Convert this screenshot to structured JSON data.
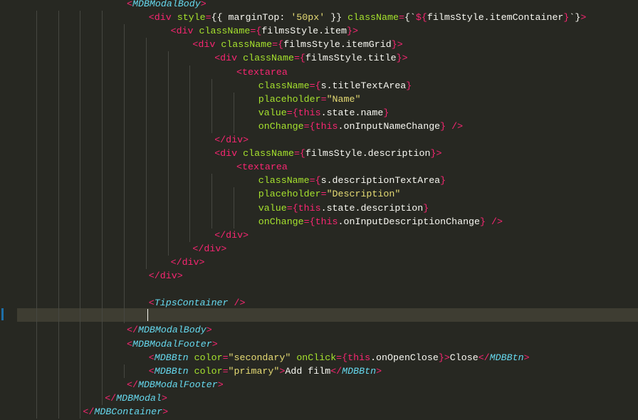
{
  "editor": {
    "theme_colors": {
      "background": "#272822",
      "tag": "#f92672",
      "component": "#66d9ef",
      "attribute": "#a6e22e",
      "string": "#e6db74",
      "text": "#f8f8f2",
      "current_line": "#3e3d32",
      "gutter_marker": "#1e6fa8"
    },
    "lines": [
      {
        "indent": 20,
        "tokens": [
          [
            "tag",
            "<"
          ],
          [
            "comp",
            "MDBModalBody"
          ],
          [
            "tag",
            ">"
          ]
        ]
      },
      {
        "indent": 24,
        "tokens": [
          [
            "tag",
            "<"
          ],
          [
            "kw",
            "div"
          ],
          [
            "plain",
            " "
          ],
          [
            "attr",
            "style"
          ],
          [
            "kw",
            "="
          ],
          [
            "plain",
            "{{ marginTop: "
          ],
          [
            "str",
            "'50px'"
          ],
          [
            "plain",
            " }} "
          ],
          [
            "attr",
            "className"
          ],
          [
            "kw",
            "="
          ],
          [
            "plain",
            "{`"
          ],
          [
            "kw",
            "${"
          ],
          [
            "plain",
            "filmsStyle.itemContainer"
          ],
          [
            "kw",
            "}"
          ],
          [
            "plain",
            "`}"
          ],
          [
            "tag",
            ">"
          ]
        ]
      },
      {
        "indent": 28,
        "tokens": [
          [
            "tag",
            "<"
          ],
          [
            "kw",
            "div"
          ],
          [
            "plain",
            " "
          ],
          [
            "attr",
            "className"
          ],
          [
            "kw",
            "="
          ],
          [
            "kw",
            "{"
          ],
          [
            "plain",
            "filmsStyle.item"
          ],
          [
            "kw",
            "}"
          ],
          [
            "tag",
            ">"
          ]
        ]
      },
      {
        "indent": 32,
        "tokens": [
          [
            "tag",
            "<"
          ],
          [
            "kw",
            "div"
          ],
          [
            "plain",
            " "
          ],
          [
            "attr",
            "className"
          ],
          [
            "kw",
            "="
          ],
          [
            "kw",
            "{"
          ],
          [
            "plain",
            "filmsStyle.itemGrid"
          ],
          [
            "kw",
            "}"
          ],
          [
            "tag",
            ">"
          ]
        ]
      },
      {
        "indent": 36,
        "tokens": [
          [
            "tag",
            "<"
          ],
          [
            "kw",
            "div"
          ],
          [
            "plain",
            " "
          ],
          [
            "attr",
            "className"
          ],
          [
            "kw",
            "="
          ],
          [
            "kw",
            "{"
          ],
          [
            "plain",
            "filmsStyle.title"
          ],
          [
            "kw",
            "}"
          ],
          [
            "tag",
            ">"
          ]
        ]
      },
      {
        "indent": 40,
        "tokens": [
          [
            "tag",
            "<"
          ],
          [
            "kw",
            "textarea"
          ]
        ]
      },
      {
        "indent": 44,
        "tokens": [
          [
            "attr",
            "className"
          ],
          [
            "kw",
            "="
          ],
          [
            "kw",
            "{"
          ],
          [
            "plain",
            "s.titleTextArea"
          ],
          [
            "kw",
            "}"
          ]
        ]
      },
      {
        "indent": 44,
        "tokens": [
          [
            "attr",
            "placeholder"
          ],
          [
            "kw",
            "="
          ],
          [
            "str",
            "\"Name\""
          ]
        ]
      },
      {
        "indent": 44,
        "tokens": [
          [
            "attr",
            "value"
          ],
          [
            "kw",
            "="
          ],
          [
            "kw",
            "{"
          ],
          [
            "kw",
            "this"
          ],
          [
            "plain",
            ".state.name"
          ],
          [
            "kw",
            "}"
          ]
        ]
      },
      {
        "indent": 44,
        "tokens": [
          [
            "attr",
            "onChange"
          ],
          [
            "kw",
            "="
          ],
          [
            "kw",
            "{"
          ],
          [
            "kw",
            "this"
          ],
          [
            "plain",
            ".onInputNameChange"
          ],
          [
            "kw",
            "}"
          ],
          [
            "plain",
            " "
          ],
          [
            "tag",
            "/>"
          ]
        ]
      },
      {
        "indent": 36,
        "tokens": [
          [
            "tag",
            "</"
          ],
          [
            "kw",
            "div"
          ],
          [
            "tag",
            ">"
          ]
        ]
      },
      {
        "indent": 36,
        "tokens": [
          [
            "tag",
            "<"
          ],
          [
            "kw",
            "div"
          ],
          [
            "plain",
            " "
          ],
          [
            "attr",
            "className"
          ],
          [
            "kw",
            "="
          ],
          [
            "kw",
            "{"
          ],
          [
            "plain",
            "filmsStyle.description"
          ],
          [
            "kw",
            "}"
          ],
          [
            "tag",
            ">"
          ]
        ]
      },
      {
        "indent": 40,
        "tokens": [
          [
            "tag",
            "<"
          ],
          [
            "kw",
            "textarea"
          ]
        ]
      },
      {
        "indent": 44,
        "tokens": [
          [
            "attr",
            "className"
          ],
          [
            "kw",
            "="
          ],
          [
            "kw",
            "{"
          ],
          [
            "plain",
            "s.descriptionTextArea"
          ],
          [
            "kw",
            "}"
          ]
        ]
      },
      {
        "indent": 44,
        "tokens": [
          [
            "attr",
            "placeholder"
          ],
          [
            "kw",
            "="
          ],
          [
            "str",
            "\"Description\""
          ]
        ]
      },
      {
        "indent": 44,
        "tokens": [
          [
            "attr",
            "value"
          ],
          [
            "kw",
            "="
          ],
          [
            "kw",
            "{"
          ],
          [
            "kw",
            "this"
          ],
          [
            "plain",
            ".state.description"
          ],
          [
            "kw",
            "}"
          ]
        ]
      },
      {
        "indent": 44,
        "tokens": [
          [
            "attr",
            "onChange"
          ],
          [
            "kw",
            "="
          ],
          [
            "kw",
            "{"
          ],
          [
            "kw",
            "this"
          ],
          [
            "plain",
            ".onInputDescriptionChange"
          ],
          [
            "kw",
            "}"
          ],
          [
            "plain",
            " "
          ],
          [
            "tag",
            "/>"
          ]
        ]
      },
      {
        "indent": 36,
        "tokens": [
          [
            "tag",
            "</"
          ],
          [
            "kw",
            "div"
          ],
          [
            "tag",
            ">"
          ]
        ]
      },
      {
        "indent": 32,
        "tokens": [
          [
            "tag",
            "</"
          ],
          [
            "kw",
            "div"
          ],
          [
            "tag",
            ">"
          ]
        ]
      },
      {
        "indent": 28,
        "tokens": [
          [
            "tag",
            "</"
          ],
          [
            "kw",
            "div"
          ],
          [
            "tag",
            ">"
          ]
        ]
      },
      {
        "indent": 24,
        "tokens": [
          [
            "tag",
            "</"
          ],
          [
            "kw",
            "div"
          ],
          [
            "tag",
            ">"
          ]
        ]
      },
      {
        "indent": 0,
        "tokens": []
      },
      {
        "indent": 24,
        "tokens": [
          [
            "tag",
            "<"
          ],
          [
            "comp",
            "TipsContainer"
          ],
          [
            "plain",
            " "
          ],
          [
            "tag",
            "/>"
          ]
        ]
      },
      {
        "indent": 0,
        "tokens": []
      },
      {
        "indent": 20,
        "tokens": [
          [
            "tag",
            "</"
          ],
          [
            "comp",
            "MDBModalBody"
          ],
          [
            "tag",
            ">"
          ]
        ]
      },
      {
        "indent": 20,
        "tokens": [
          [
            "tag",
            "<"
          ],
          [
            "comp",
            "MDBModalFooter"
          ],
          [
            "tag",
            ">"
          ]
        ]
      },
      {
        "indent": 24,
        "tokens": [
          [
            "tag",
            "<"
          ],
          [
            "comp",
            "MDBBtn"
          ],
          [
            "plain",
            " "
          ],
          [
            "attr",
            "color"
          ],
          [
            "kw",
            "="
          ],
          [
            "str",
            "\"secondary\""
          ],
          [
            "plain",
            " "
          ],
          [
            "attr",
            "onClick"
          ],
          [
            "kw",
            "="
          ],
          [
            "kw",
            "{"
          ],
          [
            "kw",
            "this"
          ],
          [
            "plain",
            ".onOpenClose"
          ],
          [
            "kw",
            "}"
          ],
          [
            "tag",
            ">"
          ],
          [
            "plain",
            "Close"
          ],
          [
            "tag",
            "</"
          ],
          [
            "comp",
            "MDBBtn"
          ],
          [
            "tag",
            ">"
          ]
        ]
      },
      {
        "indent": 24,
        "tokens": [
          [
            "tag",
            "<"
          ],
          [
            "comp",
            "MDBBtn"
          ],
          [
            "plain",
            " "
          ],
          [
            "attr",
            "color"
          ],
          [
            "kw",
            "="
          ],
          [
            "str",
            "\"primary\""
          ],
          [
            "tag",
            ">"
          ],
          [
            "plain",
            "Add film"
          ],
          [
            "tag",
            "</"
          ],
          [
            "comp",
            "MDBBtn"
          ],
          [
            "tag",
            ">"
          ]
        ]
      },
      {
        "indent": 20,
        "tokens": [
          [
            "tag",
            "</"
          ],
          [
            "comp",
            "MDBModalFooter"
          ],
          [
            "tag",
            ">"
          ]
        ]
      },
      {
        "indent": 16,
        "tokens": [
          [
            "tag",
            "</"
          ],
          [
            "comp",
            "MDBModal"
          ],
          [
            "tag",
            ">"
          ]
        ]
      },
      {
        "indent": 12,
        "tokens": [
          [
            "tag",
            "</"
          ],
          [
            "comp",
            "MDBContainer"
          ],
          [
            "tag",
            ">"
          ]
        ]
      }
    ]
  }
}
